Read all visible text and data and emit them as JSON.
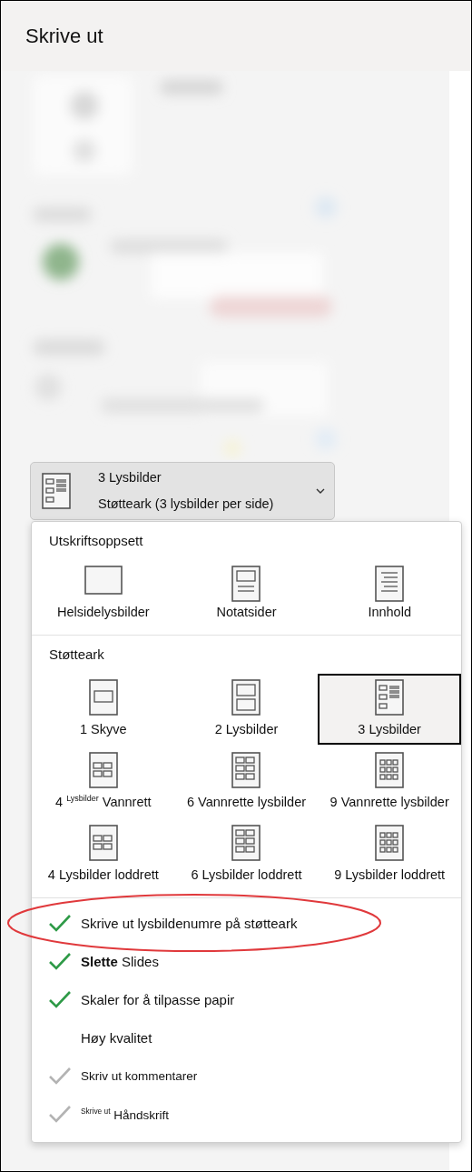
{
  "title": "Skrive ut",
  "layout_dropdown": {
    "title": "3 Lysbilder",
    "subtitle": "Støtteark (3 lysbilder per side)",
    "kind": "h3"
  },
  "menu": {
    "sections": [
      {
        "heading": "Utskriftsoppsett",
        "items": [
          {
            "label": "Helsidelysbilder",
            "kind": "full",
            "selected": false
          },
          {
            "label": "Notatsider",
            "kind": "notes",
            "selected": false
          },
          {
            "label": "Innhold",
            "kind": "outline",
            "selected": false
          }
        ]
      },
      {
        "heading": "Støtteark",
        "items": [
          {
            "label": "1 Skyve",
            "kind": "h1",
            "selected": false
          },
          {
            "label": "2 Lysbilder",
            "kind": "h2",
            "selected": false
          },
          {
            "label": "3 Lysbilder",
            "kind": "h3",
            "selected": true
          },
          {
            "label": "4 $^{Lysbilder}$ Vannrett",
            "kind": "g4",
            "selected": false
          },
          {
            "label": "6 Vannrette lysbilder",
            "kind": "g6",
            "selected": false
          },
          {
            "label": "9 Vannrette lysbilder",
            "kind": "g9",
            "selected": false
          },
          {
            "label": "4 Lysbilder loddrett",
            "kind": "g4",
            "selected": false
          },
          {
            "label": "6 Lysbilder loddrett",
            "kind": "g6",
            "selected": false
          },
          {
            "label": "9 Lysbilder loddrett",
            "kind": "g9",
            "selected": false
          }
        ]
      }
    ],
    "options": [
      {
        "label": "Skrive ut lysbildenumre på støtteark",
        "checked": true,
        "disabled": false,
        "circled": true
      },
      {
        "label": "**Slette** Slides",
        "checked": true,
        "disabled": false,
        "circled": false
      },
      {
        "label": "Skaler for å tilpasse papir",
        "checked": true,
        "disabled": false,
        "circled": false
      },
      {
        "label": "Høy kvalitet",
        "checked": false,
        "disabled": false,
        "circled": false
      },
      {
        "label": "Skriv ut kommentarer",
        "checked": true,
        "disabled": true,
        "circled": false
      },
      {
        "label": "$^{Skrive ut}$ Håndskrift",
        "checked": true,
        "disabled": true,
        "circled": false
      }
    ]
  }
}
